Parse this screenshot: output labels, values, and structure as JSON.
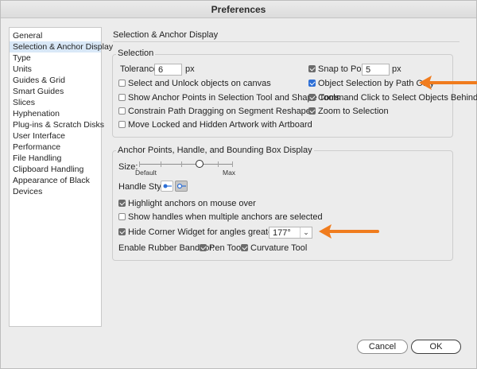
{
  "window": {
    "title": "Preferences"
  },
  "sidebar": {
    "items": [
      {
        "label": "General",
        "selected": false
      },
      {
        "label": "Selection & Anchor Display",
        "selected": true
      },
      {
        "label": "Type",
        "selected": false
      },
      {
        "label": "Units",
        "selected": false
      },
      {
        "label": "Guides & Grid",
        "selected": false
      },
      {
        "label": "Smart Guides",
        "selected": false
      },
      {
        "label": "Slices",
        "selected": false
      },
      {
        "label": "Hyphenation",
        "selected": false
      },
      {
        "label": "Plug-ins & Scratch Disks",
        "selected": false
      },
      {
        "label": "User Interface",
        "selected": false
      },
      {
        "label": "Performance",
        "selected": false
      },
      {
        "label": "File Handling",
        "selected": false
      },
      {
        "label": "Clipboard Handling",
        "selected": false
      },
      {
        "label": "Appearance of Black",
        "selected": false
      },
      {
        "label": "Devices",
        "selected": false
      }
    ]
  },
  "pane": {
    "title": "Selection & Anchor Display"
  },
  "selection": {
    "label": "Selection",
    "tolerance_label": "Tolerance:",
    "tolerance_value": "6",
    "tolerance_unit": "px",
    "snap_label": "Snap to Point",
    "snap_checked": true,
    "snap_value": "5",
    "snap_unit": "px",
    "options": {
      "select_unlock": {
        "label": "Select and Unlock objects on canvas",
        "checked": false
      },
      "show_anchor_points": {
        "label": "Show Anchor Points in Selection Tool and Shape Tools",
        "checked": false
      },
      "constrain_path": {
        "label": "Constrain Path Dragging on Segment Reshape",
        "checked": false
      },
      "move_locked": {
        "label": "Move Locked and Hidden Artwork with Artboard",
        "checked": false
      },
      "object_by_path": {
        "label": "Object Selection by Path Only",
        "checked": true
      },
      "command_click": {
        "label": "Command Click to Select Objects Behind",
        "checked": true
      },
      "zoom_to_selection": {
        "label": "Zoom to Selection",
        "checked": true
      }
    }
  },
  "anchor": {
    "label": "Anchor Points, Handle, and Bounding Box Display",
    "size_label": "Size:",
    "size_min_label": "Default",
    "size_max_label": "Max",
    "size_level_fraction": 0.64,
    "handle_style_label": "Handle Style:",
    "handle_style_selected_index": 1,
    "highlight": {
      "label": "Highlight anchors on mouse over",
      "checked": true
    },
    "show_handles": {
      "label": "Show handles when multiple anchors are selected",
      "checked": false
    },
    "hide_corner": {
      "label": "Hide Corner Widget for angles greater than:",
      "checked": true,
      "value": "177°"
    },
    "rubber_band_label": "Enable Rubber Band for:",
    "pen_tool": {
      "label": "Pen Tool",
      "checked": true
    },
    "curvature_tool": {
      "label": "Curvature Tool",
      "checked": true
    }
  },
  "buttons": {
    "cancel": "Cancel",
    "ok": "OK"
  },
  "annotations": {
    "arrow_color": "#f07c1e"
  },
  "colors": {
    "checkbox_checked": "#6b6b6b",
    "checkbox_focus": "#2d6fd6",
    "sidebar_selected": "#d9e8f7"
  }
}
